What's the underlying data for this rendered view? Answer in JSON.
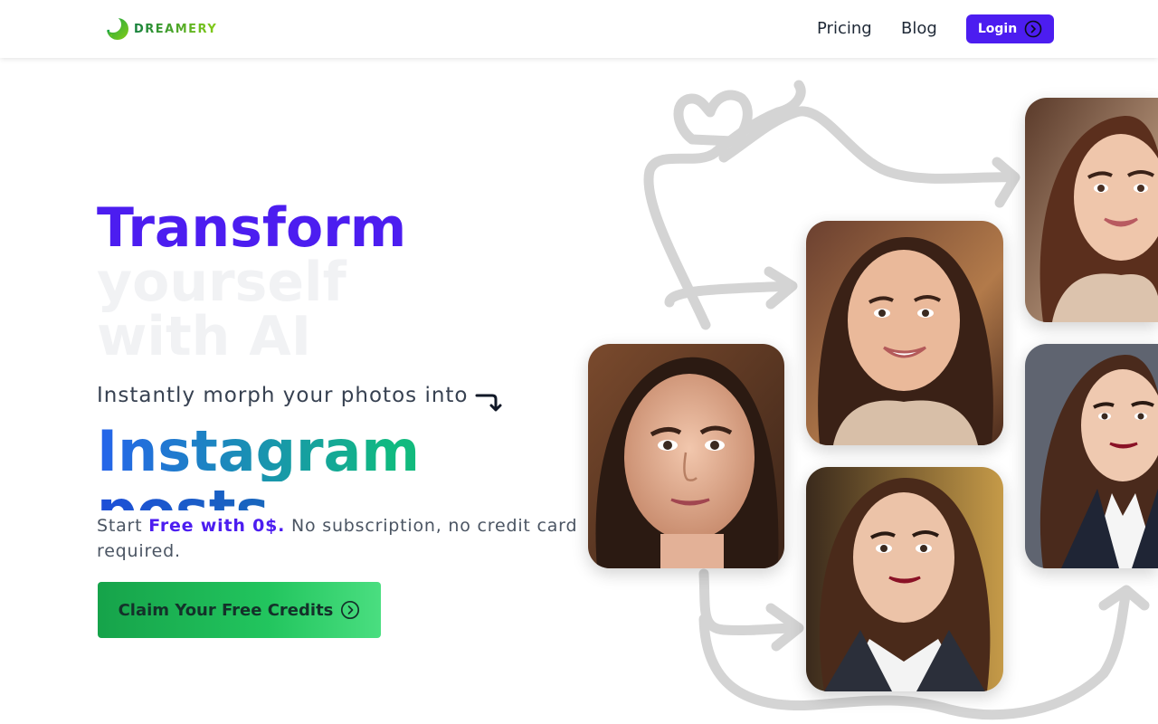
{
  "brand": {
    "name": "DREAMERY"
  },
  "nav": {
    "links": [
      "Pricing",
      "Blog"
    ],
    "login_label": "Login"
  },
  "hero": {
    "headline_1": "Transform",
    "headline_2": "yourself",
    "headline_3": "with AI",
    "subline": "Instantly morph your photos into",
    "rotating_words": [
      "Instagram",
      "posts"
    ],
    "start_prefix": "Start ",
    "start_free": "Free with 0$.",
    "start_suffix": " No subscription, no credit card required.",
    "cta_label": "Claim Your Free Credits"
  },
  "gallery": {
    "photos": [
      "portrait-woman-closeup",
      "portrait-woman-smiling-sweater",
      "portrait-woman-blazer",
      "portrait-woman-beige-cardigan",
      "portrait-woman-dark-blazer"
    ]
  },
  "colors": {
    "accent": "#4c1df0",
    "cta_start": "#16a34a",
    "cta_end": "#4ade80",
    "doodle": "#d1d5db"
  },
  "icons": {
    "login": "chevron-circle-right-icon",
    "cta": "chevron-circle-right-icon",
    "subline": "curved-arrow-down-icon"
  }
}
